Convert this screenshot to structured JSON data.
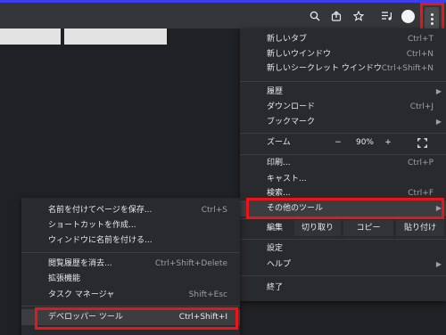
{
  "toolbar": {
    "icons": [
      "zoom-icon",
      "share-icon",
      "bookmark-star-icon",
      "media-icon",
      "profile-avatar",
      "kebab-menu-icon"
    ]
  },
  "main_menu": {
    "new_tab": {
      "label": "新しいタブ",
      "shortcut": "Ctrl+T"
    },
    "new_window": {
      "label": "新しいウインドウ",
      "shortcut": "Ctrl+N"
    },
    "new_incognito": {
      "label": "新しいシークレット ウインドウ",
      "shortcut": "Ctrl+Shift+N"
    },
    "history": {
      "label": "履歴"
    },
    "downloads": {
      "label": "ダウンロード",
      "shortcut": "Ctrl+J"
    },
    "bookmarks": {
      "label": "ブックマーク"
    },
    "zoom": {
      "label": "ズーム",
      "minus": "−",
      "value": "90%",
      "plus": "+"
    },
    "print": {
      "label": "印刷...",
      "shortcut": "Ctrl+P"
    },
    "cast": {
      "label": "キャスト..."
    },
    "find": {
      "label": "検索...",
      "shortcut": "Ctrl+F"
    },
    "more_tools": {
      "label": "その他のツール"
    },
    "edit": {
      "label": "編集",
      "cut": "切り取り",
      "copy": "コピー",
      "paste": "貼り付け"
    },
    "settings": {
      "label": "設定"
    },
    "help": {
      "label": "ヘルプ"
    },
    "exit": {
      "label": "終了"
    }
  },
  "submenu": {
    "save_page": {
      "label": "名前を付けてページを保存...",
      "shortcut": "Ctrl+S"
    },
    "create_shortcut": {
      "label": "ショートカットを作成..."
    },
    "name_window": {
      "label": "ウィンドウに名前を付ける..."
    },
    "clear_data": {
      "label": "閲覧履歴を消去...",
      "shortcut": "Ctrl+Shift+Delete"
    },
    "extensions": {
      "label": "拡張機能"
    },
    "task_manager": {
      "label": "タスク マネージャ",
      "shortcut": "Shift+Esc"
    },
    "devtools": {
      "label": "デベロッパー ツール",
      "shortcut": "Ctrl+Shift+I"
    }
  },
  "colors": {
    "highlight": "#e8151a",
    "menu_bg": "#292a2d",
    "page_bg": "#202124"
  }
}
